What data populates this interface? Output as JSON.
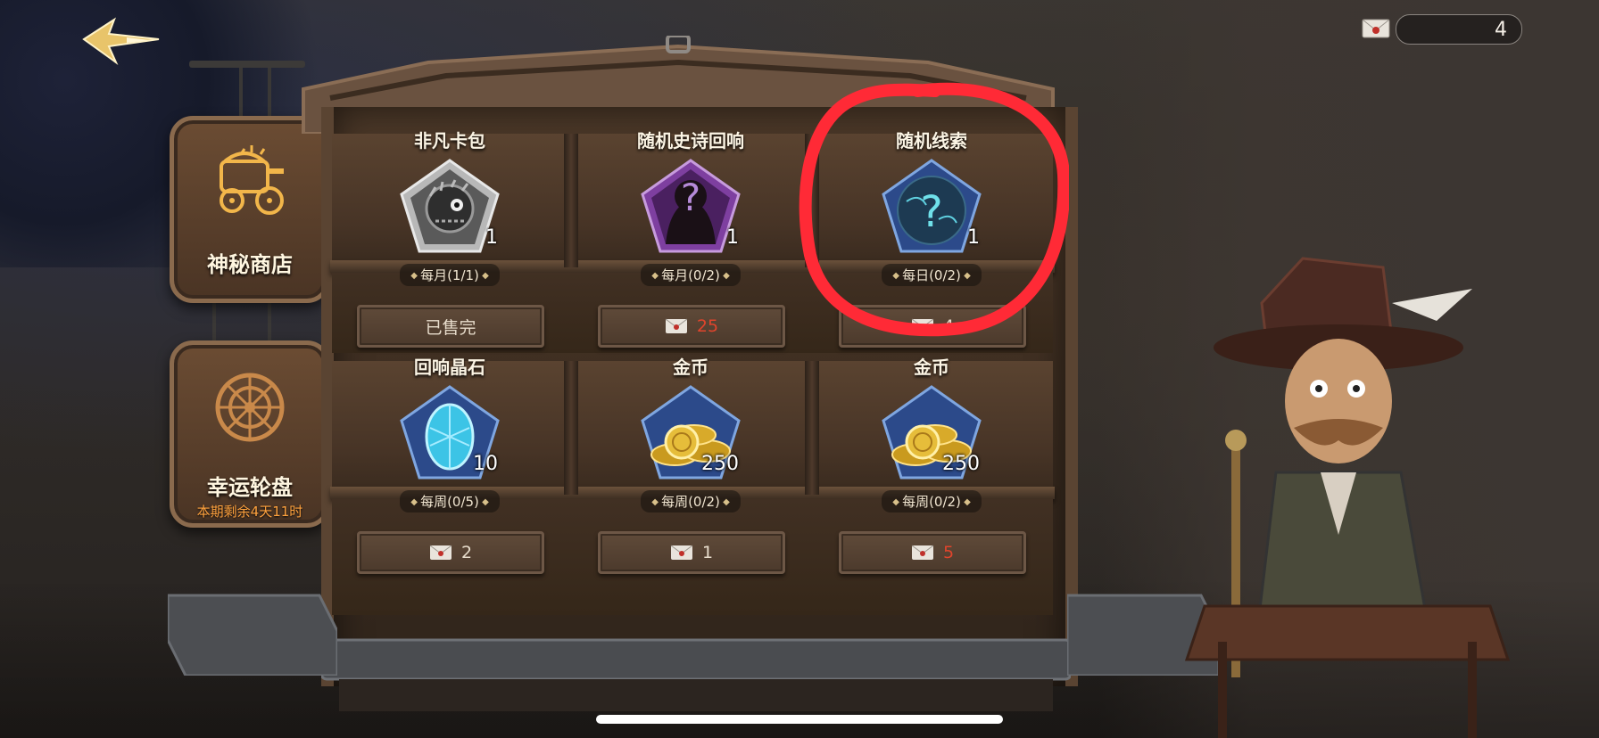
{
  "currency": {
    "icon": "ticket-icon",
    "value": "4"
  },
  "side_tabs": [
    {
      "label": "神秘商店",
      "icon": "carriage-icon"
    },
    {
      "label": "幸运轮盘",
      "icon": "wheel-icon",
      "sub": "本期剩余4天11时"
    }
  ],
  "shop": {
    "items": [
      {
        "name": "非凡卡包",
        "qty": "1",
        "limit": "每月(1/1)",
        "price_label": "已售完",
        "icon": "card-pack-icon"
      },
      {
        "name": "随机史诗回响",
        "qty": "1",
        "limit": "每月(0/2)",
        "price": "25",
        "icon": "mystery-silhouette-icon"
      },
      {
        "name": "随机线索",
        "qty": "1",
        "limit": "每日(0/2)",
        "price": "4",
        "icon": "mystery-clue-icon"
      },
      {
        "name": "回响晶石",
        "qty": "10",
        "limit": "每周(0/5)",
        "price": "2",
        "icon": "crystal-icon"
      },
      {
        "name": "金币",
        "qty": "250",
        "limit": "每周(0/2)",
        "price": "1",
        "icon": "gold-coins-icon"
      },
      {
        "name": "金币",
        "qty": "250",
        "limit": "每周(0/2)",
        "price": "5",
        "icon": "gold-coins-icon"
      }
    ]
  },
  "colors": {
    "price_red": "#e0442c",
    "highlight": "#ff2a36",
    "timer": "#ffa23e"
  }
}
